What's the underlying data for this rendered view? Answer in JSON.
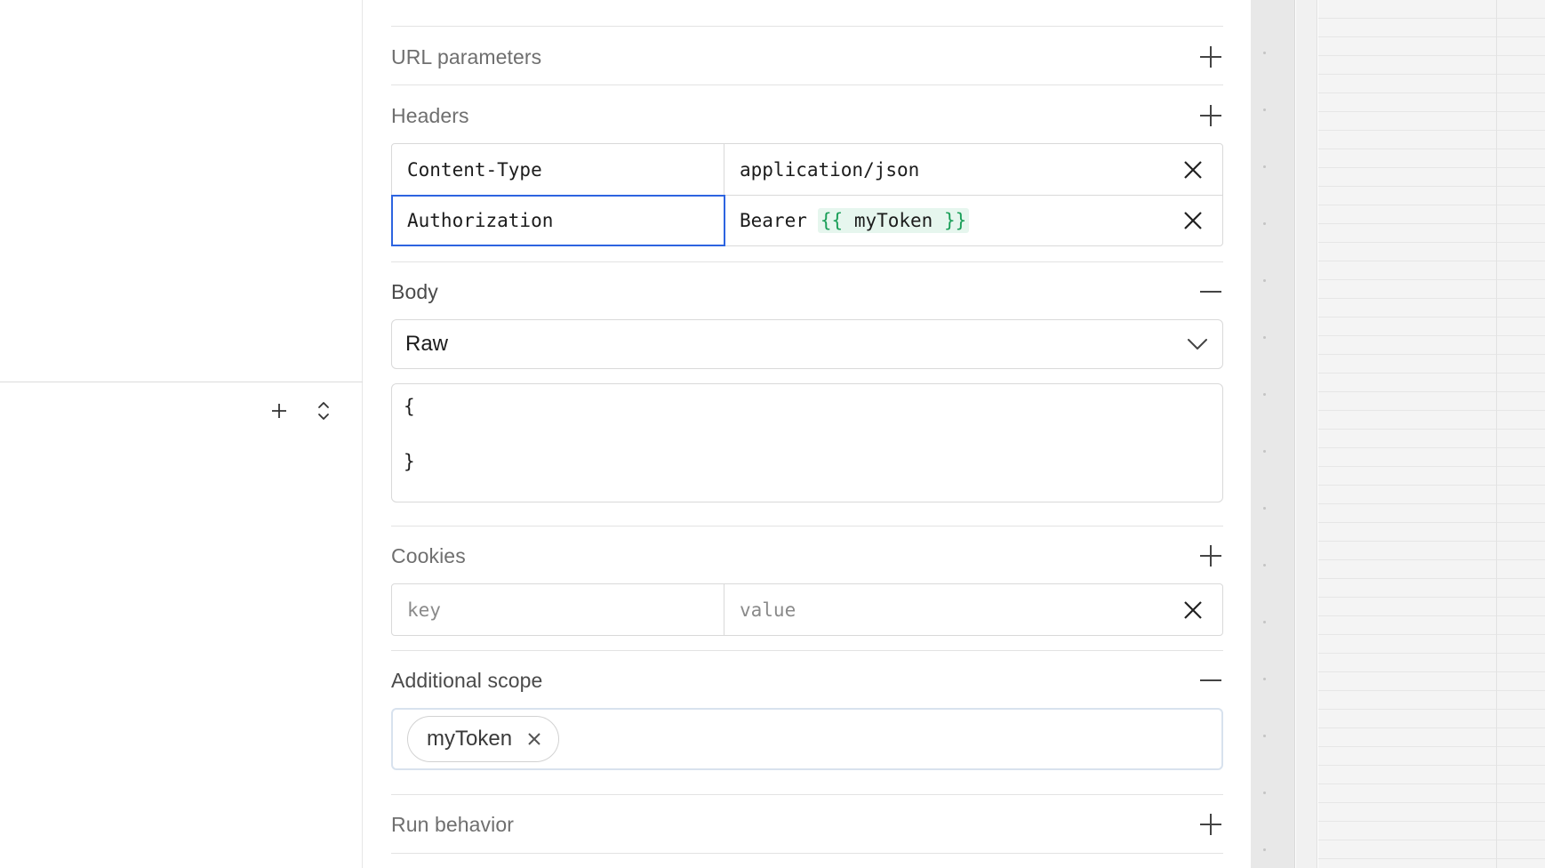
{
  "left_panel": {
    "add_icon": "plus-icon",
    "sort_icon": "chevron-up-down-icon"
  },
  "sections": {
    "url_parameters": {
      "title": "URL parameters",
      "state": "collapsed"
    },
    "headers": {
      "title": "Headers",
      "state": "collapsed",
      "rows": [
        {
          "key": "Content-Type",
          "value": "application/json"
        },
        {
          "key": "Authorization",
          "value_prefix": "Bearer",
          "token_open": "{{",
          "token_name": "myToken",
          "token_close": "}}"
        }
      ]
    },
    "body": {
      "title": "Body",
      "state": "expanded",
      "mode": "Raw",
      "code_lines": [
        "{",
        "",
        "}"
      ]
    },
    "cookies": {
      "title": "Cookies",
      "state": "collapsed",
      "key_placeholder": "key",
      "value_placeholder": "value"
    },
    "additional_scope": {
      "title": "Additional scope",
      "state": "expanded",
      "tags": [
        "myToken"
      ]
    },
    "run_behavior": {
      "title": "Run behavior",
      "state": "collapsed"
    }
  },
  "colors": {
    "focus_blue": "#2d64e0",
    "token_green": "#1a9e58",
    "token_bg": "#e6f6ee"
  }
}
